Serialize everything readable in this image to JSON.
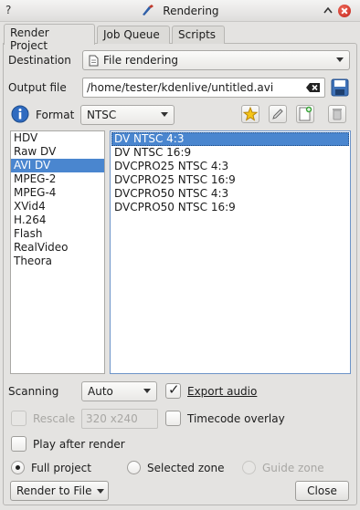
{
  "window": {
    "title": "Rendering",
    "help_glyph": "?",
    "icons": {
      "app": "kdenlive-icon",
      "help": "help-icon",
      "maximize": "maximize-icon",
      "close": "close-icon"
    }
  },
  "tabs": [
    {
      "label": "Render Project",
      "active": true
    },
    {
      "label": "Job Queue",
      "active": false
    },
    {
      "label": "Scripts",
      "active": false
    }
  ],
  "destination": {
    "label": "Destination",
    "value": "File rendering",
    "icon": "file-rendering-icon"
  },
  "output_file": {
    "label": "Output file",
    "value": "/home/tester/kdenlive/untitled.avi",
    "clear_icon": "clear-text-icon",
    "save_icon": "save-icon"
  },
  "format": {
    "info_icon": "info-icon",
    "label": "Format",
    "value": "NTSC",
    "tool_icons": [
      "favorite-star-icon",
      "edit-profile-icon",
      "new-profile-icon",
      "delete-profile-icon"
    ]
  },
  "categories": {
    "items": [
      "HDV",
      "Raw DV",
      "AVI DV",
      "MPEG-2",
      "MPEG-4",
      "XVid4",
      "H.264",
      "Flash",
      "RealVideo",
      "Theora"
    ],
    "selected_index": 2
  },
  "profiles": {
    "items": [
      "DV NTSC 4:3",
      "DV NTSC 16:9",
      "DVCPRO25 NTSC 4:3",
      "DVCPRO25 NTSC 16:9",
      "DVCPRO50 NTSC 4:3",
      "DVCPRO50 NTSC 16:9"
    ],
    "selected_index": 0
  },
  "scanning": {
    "label": "Scanning",
    "value": "Auto"
  },
  "export_audio": {
    "label": "Export audio",
    "checked": true
  },
  "rescale": {
    "label": "Rescale",
    "value": "320 x240",
    "checked": false,
    "enabled": false
  },
  "timecode_overlay": {
    "label": "Timecode overlay",
    "checked": false
  },
  "play_after_render": {
    "label": "Play after render",
    "checked": false
  },
  "zone": {
    "full_project": {
      "label": "Full project",
      "selected": true
    },
    "selected_zone": {
      "label": "Selected zone",
      "selected": false
    },
    "guide_zone": {
      "label": "Guide zone",
      "selected": false,
      "enabled": false
    }
  },
  "buttons": {
    "render": "Render to File",
    "close": "Close"
  },
  "colors": {
    "selection": "#4a86cf",
    "window_bg": "#e4e3e1"
  }
}
